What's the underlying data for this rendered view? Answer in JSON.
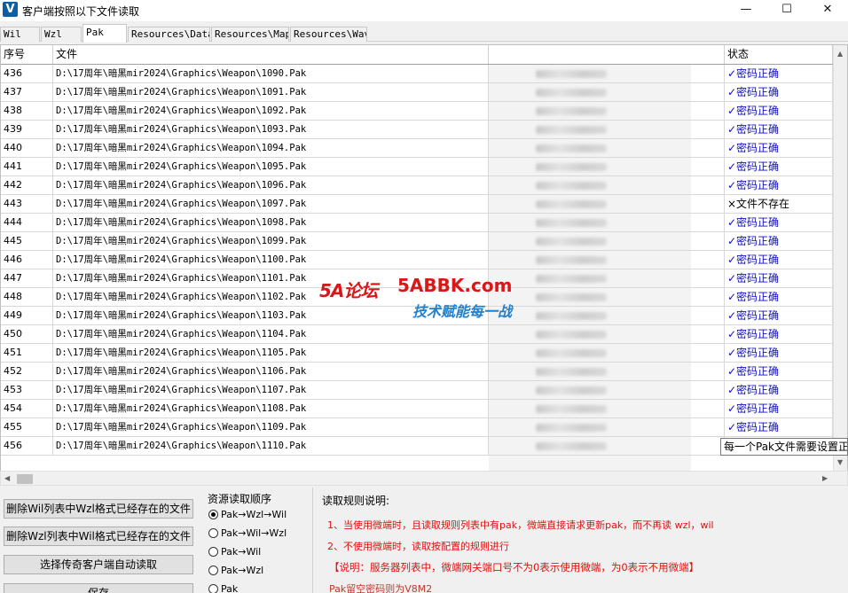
{
  "window": {
    "title": "客户端按照以下文件读取",
    "icon_label": "V",
    "controls": {
      "minimize": "—",
      "maximize": "☐",
      "close": "✕"
    }
  },
  "tabs": [
    "Wil",
    "Wzl",
    "Pak",
    "Resources\\Data",
    "Resources\\Map",
    "Resources\\Wav"
  ],
  "active_tab": "Pak",
  "table": {
    "headers": [
      "序号",
      "文件",
      "状态"
    ],
    "rows": [
      {
        "id": "436",
        "file": "D:\\17周年\\暗黑mir2024\\Graphics\\Weapon\\1090.Pak",
        "status": "✓密码正确",
        "ok": true
      },
      {
        "id": "437",
        "file": "D:\\17周年\\暗黑mir2024\\Graphics\\Weapon\\1091.Pak",
        "status": "✓密码正确",
        "ok": true
      },
      {
        "id": "438",
        "file": "D:\\17周年\\暗黑mir2024\\Graphics\\Weapon\\1092.Pak",
        "status": "✓密码正确",
        "ok": true
      },
      {
        "id": "439",
        "file": "D:\\17周年\\暗黑mir2024\\Graphics\\Weapon\\1093.Pak",
        "status": "✓密码正确",
        "ok": true
      },
      {
        "id": "440",
        "file": "D:\\17周年\\暗黑mir2024\\Graphics\\Weapon\\1094.Pak",
        "status": "✓密码正确",
        "ok": true
      },
      {
        "id": "441",
        "file": "D:\\17周年\\暗黑mir2024\\Graphics\\Weapon\\1095.Pak",
        "status": "✓密码正确",
        "ok": true
      },
      {
        "id": "442",
        "file": "D:\\17周年\\暗黑mir2024\\Graphics\\Weapon\\1096.Pak",
        "status": "✓密码正确",
        "ok": true
      },
      {
        "id": "443",
        "file": "D:\\17周年\\暗黑mir2024\\Graphics\\Weapon\\1097.Pak",
        "status": "×文件不存在",
        "ok": false
      },
      {
        "id": "444",
        "file": "D:\\17周年\\暗黑mir2024\\Graphics\\Weapon\\1098.Pak",
        "status": "✓密码正确",
        "ok": true
      },
      {
        "id": "445",
        "file": "D:\\17周年\\暗黑mir2024\\Graphics\\Weapon\\1099.Pak",
        "status": "✓密码正确",
        "ok": true
      },
      {
        "id": "446",
        "file": "D:\\17周年\\暗黑mir2024\\Graphics\\Weapon\\1100.Pak",
        "status": "✓密码正确",
        "ok": true
      },
      {
        "id": "447",
        "file": "D:\\17周年\\暗黑mir2024\\Graphics\\Weapon\\1101.Pak",
        "status": "✓密码正确",
        "ok": true
      },
      {
        "id": "448",
        "file": "D:\\17周年\\暗黑mir2024\\Graphics\\Weapon\\1102.Pak",
        "status": "✓密码正确",
        "ok": true
      },
      {
        "id": "449",
        "file": "D:\\17周年\\暗黑mir2024\\Graphics\\Weapon\\1103.Pak",
        "status": "✓密码正确",
        "ok": true
      },
      {
        "id": "450",
        "file": "D:\\17周年\\暗黑mir2024\\Graphics\\Weapon\\1104.Pak",
        "status": "✓密码正确",
        "ok": true
      },
      {
        "id": "451",
        "file": "D:\\17周年\\暗黑mir2024\\Graphics\\Weapon\\1105.Pak",
        "status": "✓密码正确",
        "ok": true
      },
      {
        "id": "452",
        "file": "D:\\17周年\\暗黑mir2024\\Graphics\\Weapon\\1106.Pak",
        "status": "✓密码正确",
        "ok": true
      },
      {
        "id": "453",
        "file": "D:\\17周年\\暗黑mir2024\\Graphics\\Weapon\\1107.Pak",
        "status": "✓密码正确",
        "ok": true
      },
      {
        "id": "454",
        "file": "D:\\17周年\\暗黑mir2024\\Graphics\\Weapon\\1108.Pak",
        "status": "✓密码正确",
        "ok": true
      },
      {
        "id": "455",
        "file": "D:\\17周年\\暗黑mir2024\\Graphics\\Weapon\\1109.Pak",
        "status": "✓密码正确",
        "ok": true
      },
      {
        "id": "456",
        "file": "D:\\17周年\\暗黑mir2024\\Graphics\\Weapon\\1110.Pak",
        "status": "",
        "ok": true
      }
    ]
  },
  "tooltip": "每一个Pak文件需要设置正",
  "watermark": {
    "logo": "5A论坛",
    "site": "5ABBK.com",
    "slogan": "技术赋能每一战"
  },
  "buttons": {
    "delete_wil": "删除Wil列表中Wzl格式已经存在的文件",
    "delete_wzl": "删除Wzl列表中Wil格式已经存在的文件",
    "auto_read": "选择传奇客户端自动读取",
    "save": "保存"
  },
  "order_group": {
    "title": "资源读取顺序",
    "options": [
      "Pak→Wzl→Wil",
      "Pak→Wil→Wzl",
      "Pak→Wil",
      "Pak→Wzl",
      "Pak"
    ],
    "selected_index": 0
  },
  "rules": {
    "title": "读取规则说明:",
    "line1": "1、当使用微端时，且读取规则列表中有pak，微端直接请求更新pak，而不再读 wzl，wil",
    "line2": "2、不使用微端时，读取按配置的规则进行",
    "note": "【说明：服务器列表中，微端网关端口号不为0表示使用微端，为0表示不用微端】",
    "last": "Pak留空密码则为V8M2"
  },
  "colors": {
    "status_ok": "#1010b8",
    "rule_red": "#e01010",
    "watermark_red": "#d81818",
    "watermark_blue": "#2480c8"
  }
}
